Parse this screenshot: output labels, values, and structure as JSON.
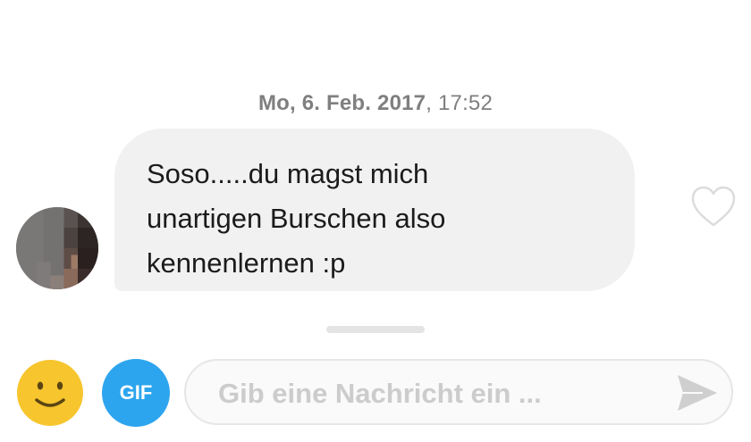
{
  "timestamp": {
    "date": "Mo, 6. Feb. 2017",
    "time": ", 17:52"
  },
  "message": {
    "lines": [
      "Soso.....du magst mich",
      "unartigen Burschen also",
      "kennenlernen :p"
    ]
  },
  "composer": {
    "gif_label": "GIF",
    "placeholder": "Gib eine Nachricht ein ..."
  },
  "icons": {
    "like": "heart-outline-icon",
    "emoji": "smiley-icon",
    "send": "send-arrow-icon"
  },
  "colors": {
    "bubble": "#f1f1f1",
    "gif_button": "#2da5ee",
    "emoji": "#f7c52d",
    "timestamp": "#7f7f7f"
  }
}
